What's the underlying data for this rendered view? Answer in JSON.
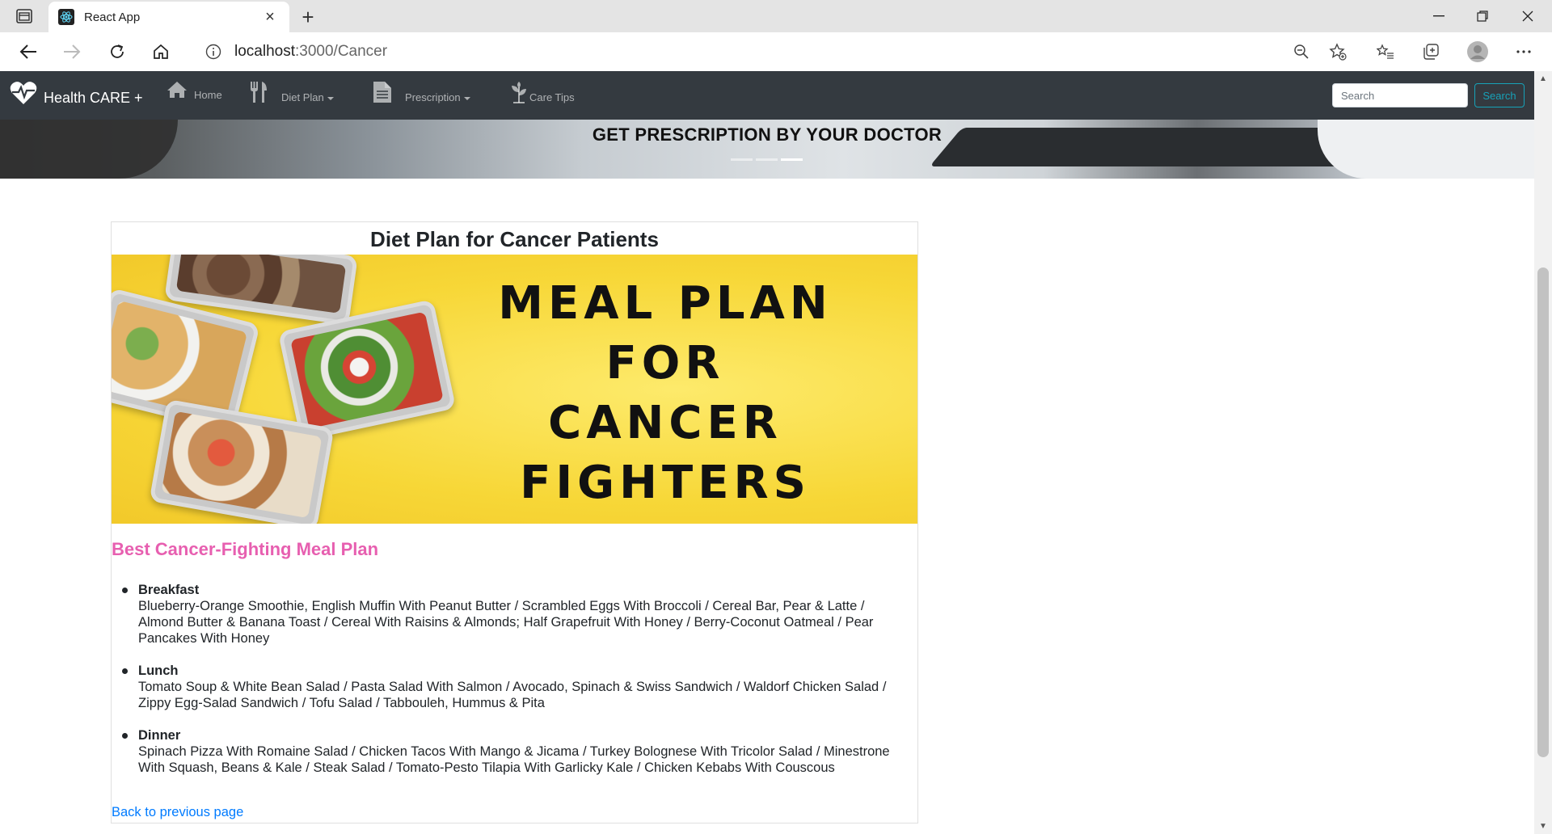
{
  "browser": {
    "tab_title": "React App",
    "url_host": "localhost",
    "url_path": ":3000/Cancer"
  },
  "navbar": {
    "brand": "Health CARE +",
    "items": [
      {
        "label": "Home",
        "icon": "home-icon"
      },
      {
        "label": "Diet Plan",
        "icon": "utensils-icon",
        "dropdown": true
      },
      {
        "label": "Prescription",
        "icon": "document-icon",
        "dropdown": true
      },
      {
        "label": "Care Tips",
        "icon": "leaf-icon"
      }
    ],
    "search_placeholder": "Search",
    "search_button": "Search"
  },
  "hero": {
    "title": "GET PRESCRIPTION BY YOUR DOCTOR",
    "active_slide": 3,
    "slide_count": 3
  },
  "card": {
    "title": "Diet Plan for Cancer Patients",
    "banner_lines": [
      "MEAL PLAN",
      "FOR",
      "CANCER",
      "FIGHTERS"
    ],
    "section_title": "Best Cancer-Fighting Meal Plan",
    "meals": [
      {
        "name": "Breakfast",
        "items": "Blueberry-Orange Smoothie, English Muffin With Peanut Butter / Scrambled Eggs With Broccoli / Cereal Bar, Pear & Latte / Almond Butter & Banana Toast / Cereal With Raisins & Almonds; Half Grapefruit With Honey / Berry-Coconut Oatmeal / Pear Pancakes With Honey"
      },
      {
        "name": "Lunch",
        "items": "Tomato Soup & White Bean Salad / Pasta Salad With Salmon / Avocado, Spinach & Swiss Sandwich / Waldorf Chicken Salad / Zippy Egg-Salad Sandwich / Tofu Salad / Tabbouleh, Hummus & Pita"
      },
      {
        "name": "Dinner",
        "items": "Spinach Pizza With Romaine Salad / Chicken Tacos With Mango & Jicama / Turkey Bolognese With Tricolor Salad / Minestrone With Squash, Beans & Kale / Steak Salad / Tomato-Pesto Tilapia With Garlicky Kale / Chicken Kebabs With Couscous"
      }
    ],
    "back_link": "Back to previous page"
  },
  "colors": {
    "navbar_bg": "#343a40",
    "section_title": "#e75fb0",
    "link": "#007bff",
    "search_btn": "#17a2b8",
    "banner_bg": "#f8d940"
  }
}
